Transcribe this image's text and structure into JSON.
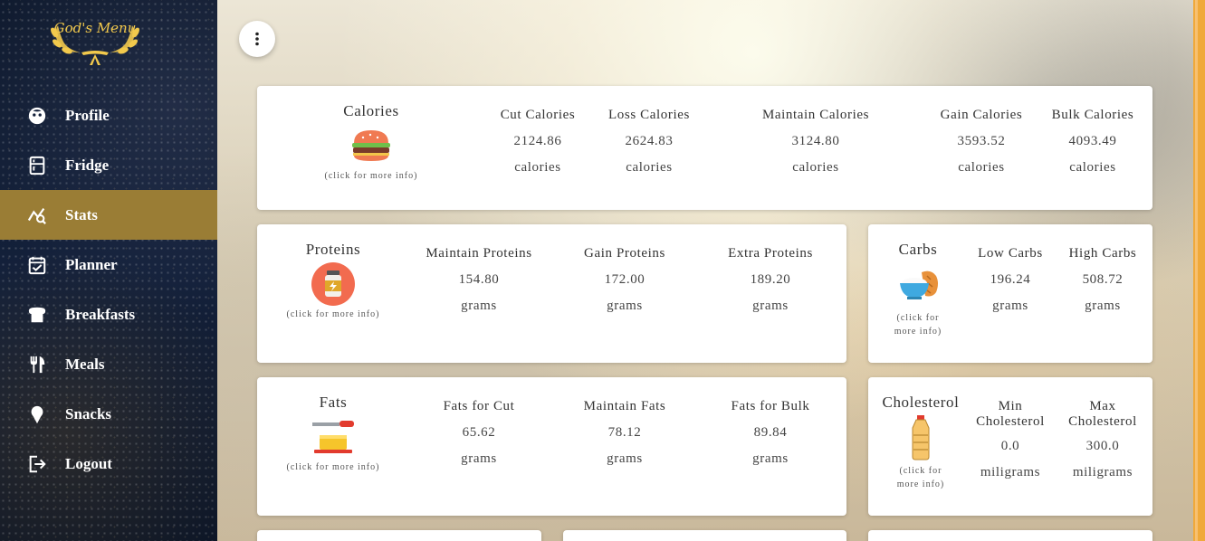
{
  "app": {
    "logo_text": "God's Menu"
  },
  "sidebar": {
    "items": [
      {
        "label": "Profile",
        "icon": "face-icon"
      },
      {
        "label": "Fridge",
        "icon": "fridge-icon"
      },
      {
        "label": "Stats",
        "icon": "stats-icon",
        "active": true
      },
      {
        "label": "Planner",
        "icon": "calendar-check-icon"
      },
      {
        "label": "Breakfasts",
        "icon": "toast-icon"
      },
      {
        "label": "Meals",
        "icon": "utensils-icon"
      },
      {
        "label": "Snacks",
        "icon": "ice-cream-icon"
      },
      {
        "label": "Logout",
        "icon": "logout-icon"
      }
    ]
  },
  "hint": "(click for more info)",
  "calories": {
    "title": "Calories",
    "cols": [
      {
        "head": "Cut Calories",
        "value": "2124.86",
        "unit": "calories"
      },
      {
        "head": "Loss Calories",
        "value": "2624.83",
        "unit": "calories"
      },
      {
        "head": "Maintain Calories",
        "value": "3124.80",
        "unit": "calories"
      },
      {
        "head": "Gain Calories",
        "value": "3593.52",
        "unit": "calories"
      },
      {
        "head": "Bulk Calories",
        "value": "4093.49",
        "unit": "calories"
      }
    ]
  },
  "proteins": {
    "title": "Proteins",
    "cols": [
      {
        "head": "Maintain Proteins",
        "value": "154.80",
        "unit": "grams"
      },
      {
        "head": "Gain Proteins",
        "value": "172.00",
        "unit": "grams"
      },
      {
        "head": "Extra Proteins",
        "value": "189.20",
        "unit": "grams"
      }
    ]
  },
  "carbs": {
    "title": "Carbs",
    "hint_line1": "(click for",
    "hint_line2": "more info)",
    "cols": [
      {
        "head": "Low Carbs",
        "value": "196.24",
        "unit": "grams"
      },
      {
        "head": "High Carbs",
        "value": "508.72",
        "unit": "grams"
      }
    ]
  },
  "fats": {
    "title": "Fats",
    "cols": [
      {
        "head": "Fats for Cut",
        "value": "65.62",
        "unit": "grams"
      },
      {
        "head": "Maintain Fats",
        "value": "78.12",
        "unit": "grams"
      },
      {
        "head": "Fats for Bulk",
        "value": "89.84",
        "unit": "grams"
      }
    ]
  },
  "cholesterol": {
    "title": "Cholesterol",
    "hint_line1": "(click for",
    "hint_line2": "more info)",
    "cols": [
      {
        "head_line1": "Min",
        "head_line2": "Cholesterol",
        "value": "0.0",
        "unit": "miligrams"
      },
      {
        "head_line1": "Max",
        "head_line2": "Cholesterol",
        "value": "300.0",
        "unit": "miligrams"
      }
    ]
  }
}
